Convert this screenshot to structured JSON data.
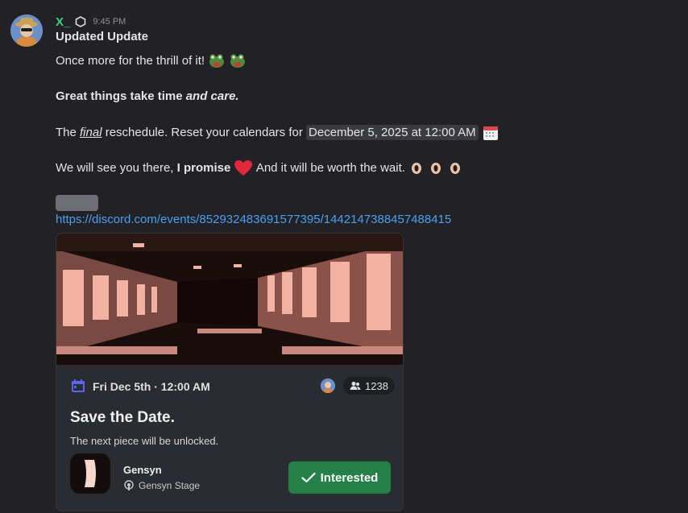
{
  "message": {
    "author": "X_",
    "timestamp": "9:45 PM",
    "heading": "Updated Update",
    "line1": "Once more for the thrill of it!",
    "line2_bold": "Great things take time ",
    "line2_italic": "and care.",
    "line3_pre": "The ",
    "line3_final": "final",
    "line3_mid": " reschedule. Reset your calendars for ",
    "line3_date": "December 5, 2025 at 12:00 AM",
    "line4_pre": "We will see you there, ",
    "line4_bold": "I promise",
    "line4_post": " And it will be worth the wait.",
    "link": "https://discord.com/events/852932483691577395/1442147388457488415"
  },
  "event_card": {
    "date": "Fri Dec 5th · 12:00 AM",
    "interested_count": "1238",
    "title": "Save the Date.",
    "description": "The next piece will be unlocked.",
    "guild_name": "Gensyn",
    "stage_name": "Gensyn Stage",
    "interested_label": "Interested"
  },
  "colors": {
    "username": "#43d17a",
    "link": "#4a9ff0",
    "interested_button": "#248046",
    "calendar_icon": "#5865f2"
  },
  "icons": [
    "server-tag-icon",
    "frog-emoji",
    "calendar-emoji",
    "red-heart-emoji",
    "eyes-emoji",
    "calendar-icon",
    "people-icon",
    "checkmark-icon",
    "stage-icon"
  ]
}
